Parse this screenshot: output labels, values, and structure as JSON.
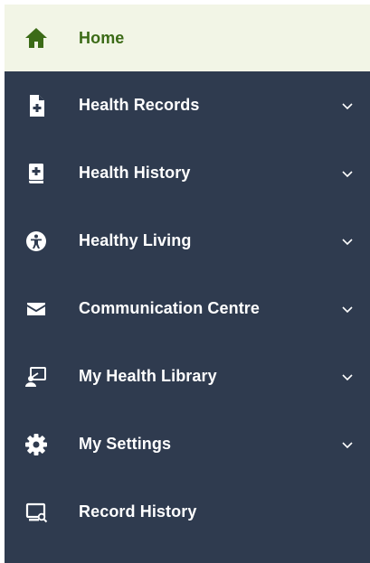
{
  "nav": {
    "items": [
      {
        "label": "Home",
        "icon": "home-icon",
        "active": true,
        "expandable": false
      },
      {
        "label": "Health Records",
        "icon": "medical-file-icon",
        "expandable": true
      },
      {
        "label": "Health History",
        "icon": "medical-book-icon",
        "expandable": true
      },
      {
        "label": "Healthy Living",
        "icon": "accessibility-icon",
        "expandable": true
      },
      {
        "label": "Communication Centre",
        "icon": "envelope-icon",
        "expandable": true
      },
      {
        "label": "My Health Library",
        "icon": "presentation-icon",
        "expandable": true
      },
      {
        "label": "My Settings",
        "icon": "gear-icon",
        "expandable": true
      },
      {
        "label": "Record History",
        "icon": "monitor-search-icon",
        "expandable": false
      }
    ]
  },
  "colors": {
    "sidebar_bg": "#2f3b4f",
    "active_bg": "#f2f5e6",
    "active_text": "#3c6b17",
    "text": "#ffffff"
  }
}
